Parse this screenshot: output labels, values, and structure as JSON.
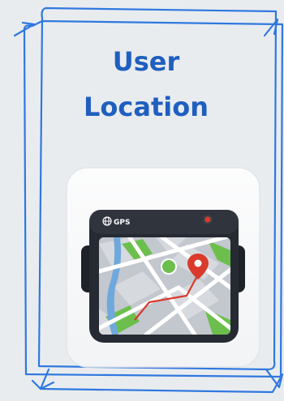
{
  "card": {
    "title_line1": "User",
    "title_line2": "Location",
    "accent_color": "#1f5fbf"
  },
  "device": {
    "label": "GPS",
    "globe_icon": "globe-icon",
    "pin_icon": "map-pin-icon",
    "record_indicator_color": "#d93a2b"
  }
}
